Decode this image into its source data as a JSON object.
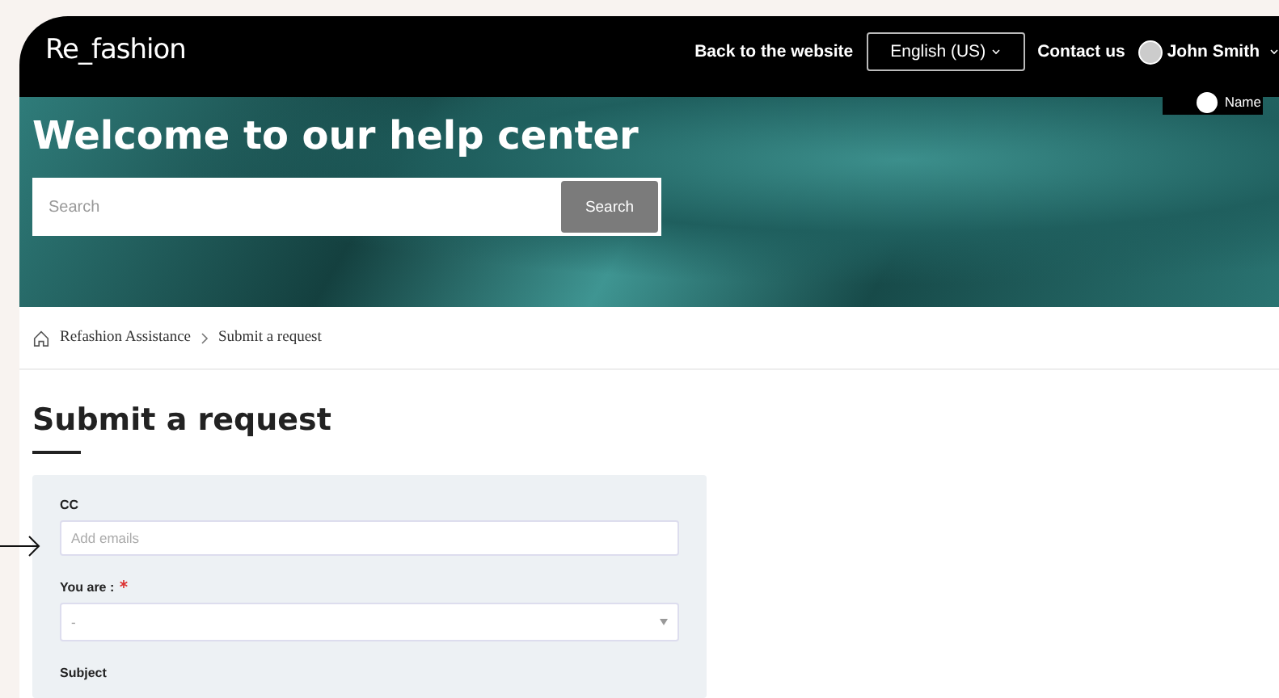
{
  "header": {
    "logo": "Re_fashion",
    "links": [
      {
        "label": "Back to the website"
      },
      {
        "label": "English (US)",
        "kind": "dropdown"
      },
      {
        "label": "Contact us"
      }
    ],
    "user": {
      "name": "John Smith"
    },
    "name_tag": "Name"
  },
  "hero": {
    "title": "Welcome to our help center",
    "search": {
      "placeholder": "Search",
      "button": "Search"
    }
  },
  "breadcrumb": [
    "Refashion Assistance",
    "Submit a request"
  ],
  "page_title": "Submit a request",
  "form": {
    "fields": [
      {
        "label": "CC",
        "kind": "text",
        "placeholder": "Add emails",
        "required": false
      },
      {
        "label": "You are :",
        "kind": "select",
        "value": "-",
        "required": true
      },
      {
        "label": "Subject",
        "kind": "label",
        "required": false
      }
    ]
  }
}
